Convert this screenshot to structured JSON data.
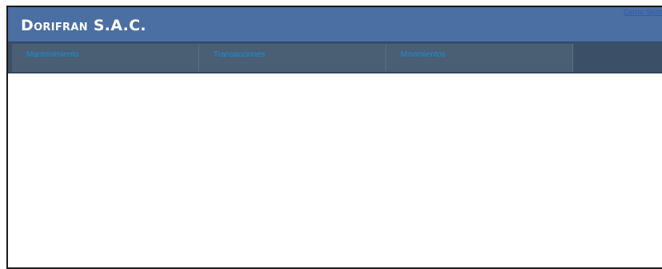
{
  "header": {
    "title": "Dorifran S.A.C.",
    "logout_label": "Cerrar Sesión"
  },
  "menu": {
    "items": [
      {
        "label": "Mantenimiento"
      },
      {
        "label": "Transacciones"
      },
      {
        "label": "Movimientos"
      }
    ]
  },
  "colors": {
    "header_bg": "#4b6ea3",
    "menu_bg": "#3b4f66",
    "menu_item_bg": "#4a5e74",
    "menu_text": "#1890d8",
    "link": "#2e5ea8"
  }
}
